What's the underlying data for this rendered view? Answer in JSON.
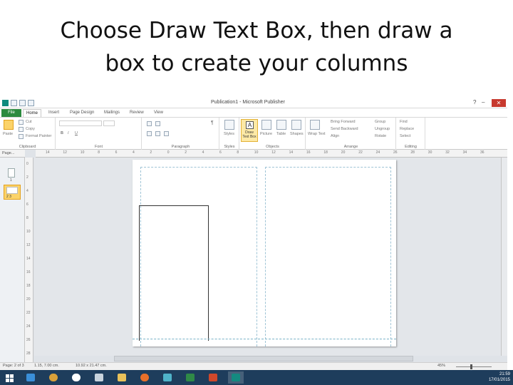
{
  "slide": {
    "title_line1": "Choose Draw Text Box, then draw a",
    "title_line2": "box to create your columns"
  },
  "window": {
    "title": "Publication1 - Microsoft Publisher",
    "minimize": "–",
    "restore": "❐",
    "close": "✕"
  },
  "ribbon_tabs": [
    "File",
    "Home",
    "Insert",
    "Page Design",
    "Mailings",
    "Review",
    "View"
  ],
  "ribbon": {
    "clipboard": {
      "paste": "Paste",
      "cut": "Cut",
      "copy": "Copy",
      "format_painter": "Format Painter",
      "label": "Clipboard"
    },
    "font": {
      "label": "Font",
      "bold": "B",
      "italic": "I",
      "underline": "U"
    },
    "paragraph": {
      "label": "Paragraph"
    },
    "styles": {
      "styles_btn": "Styles",
      "label": "Styles"
    },
    "objects": {
      "draw_text_box_line1": "Draw",
      "draw_text_box_line2": "Text Box",
      "picture": "Picture",
      "table": "Table",
      "shapes": "Shapes",
      "label": "Objects"
    },
    "arrange": {
      "wrap_text": "Wrap Text",
      "bring_forward": "Bring Forward",
      "send_backward": "Send Backward",
      "align": "Align",
      "group": "Group",
      "ungroup": "Ungroup",
      "rotate": "Rotate",
      "label": "Arrange"
    },
    "editing": {
      "find": "Find",
      "replace": "Replace",
      "select": "Select",
      "label": "Editing"
    }
  },
  "accent_colors": {
    "file_tab": "#2b8a3e",
    "selected_button": "#fde9a6",
    "taskbar": "#1e3d5c"
  },
  "ruler": {
    "h_numbers": [
      "14",
      "12",
      "10",
      "8",
      "6",
      "4",
      "2",
      "0",
      "2",
      "4",
      "6",
      "8",
      "10",
      "12",
      "14",
      "16",
      "18",
      "20",
      "22",
      "24",
      "26",
      "28",
      "30",
      "32",
      "34",
      "36"
    ],
    "v_numbers": [
      "0",
      "2",
      "4",
      "6",
      "8",
      "10",
      "12",
      "14",
      "16",
      "18",
      "20",
      "22",
      "24",
      "26",
      "28"
    ]
  },
  "pages_panel": {
    "header": "Page...",
    "thumb1_num": "1",
    "thumb2_num": "2  3"
  },
  "status": {
    "page": "Page: 2 of 3",
    "position": "1.15, 7.00 cm.",
    "size": "10.92 x 21.47 cm.",
    "zoom": "45%"
  },
  "taskbar": {
    "time": "21:59",
    "date": "17/01/2015"
  }
}
